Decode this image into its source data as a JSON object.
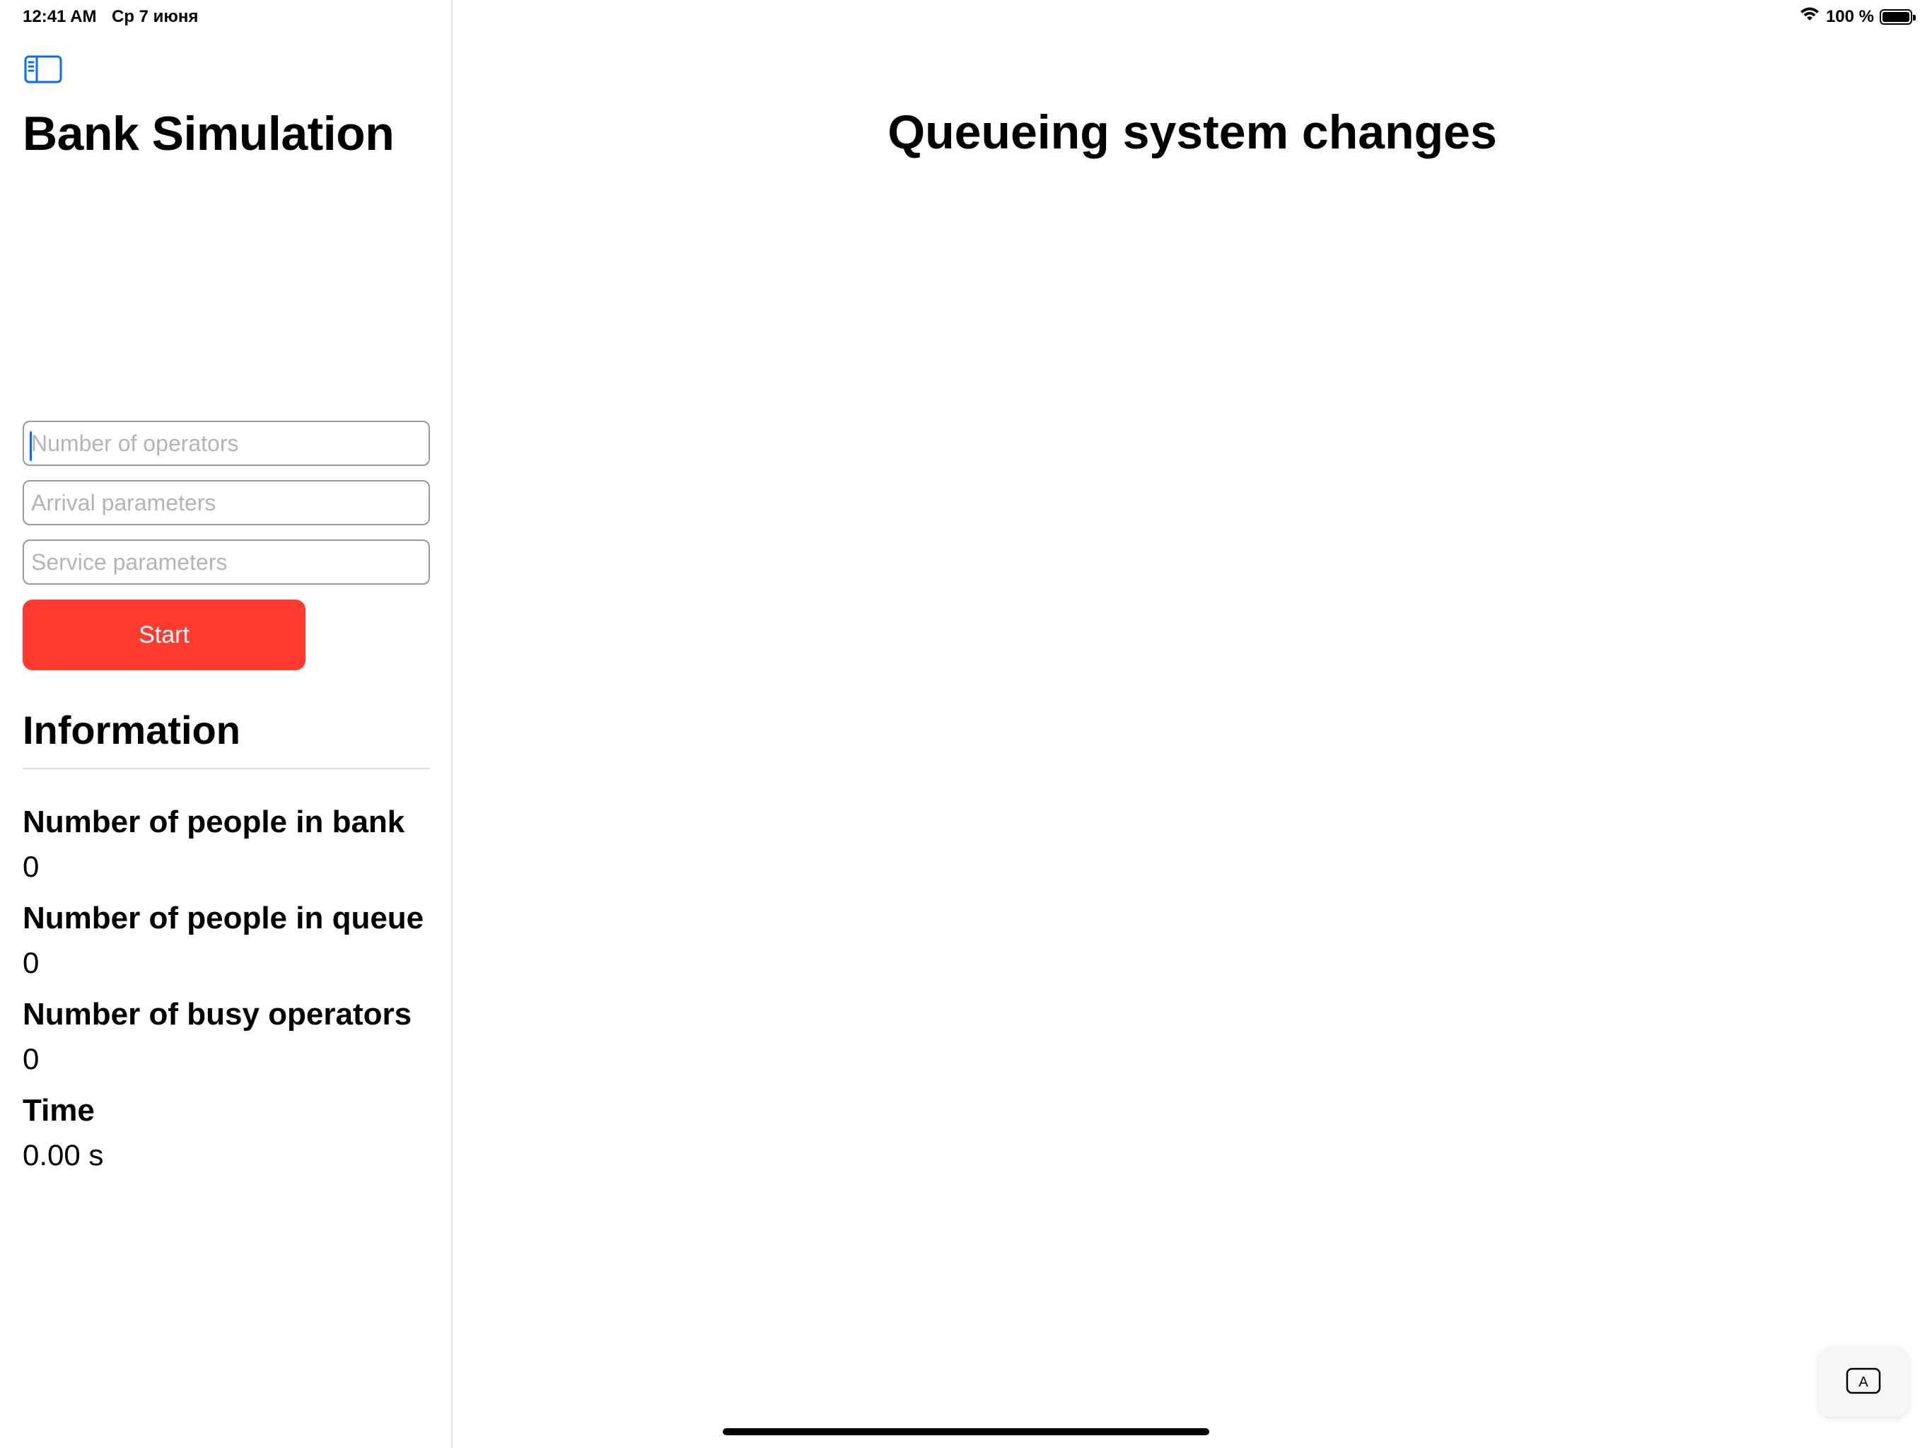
{
  "status_bar": {
    "time": "12:41 AM",
    "date": "Ср 7 июня",
    "battery": "100 %",
    "wifi_icon": "wifi-icon",
    "battery_icon": "battery-full-icon"
  },
  "sidebar": {
    "toggle_icon": "sidebar-toggle-icon",
    "title": "Bank Simulation",
    "fields": {
      "operators": {
        "value": "",
        "placeholder": "Number of operators"
      },
      "arrival": {
        "value": "",
        "placeholder": "Arrival parameters"
      },
      "service": {
        "value": "",
        "placeholder": "Service parameters"
      }
    },
    "start_label": "Start",
    "info_heading": "Information",
    "stats": [
      {
        "label": "Number of people in bank",
        "value": "0"
      },
      {
        "label": "Number of people in queue",
        "value": "0"
      },
      {
        "label": "Number of busy operators",
        "value": "0"
      },
      {
        "label": "Time",
        "value": "0.00 s"
      }
    ]
  },
  "detail": {
    "title": "Queueing system changes"
  },
  "keyboard_button": {
    "icon": "keyboard-shortcut-a-icon",
    "glyph": "A"
  },
  "colors": {
    "accent": "#0a6cff",
    "start_button": "#ff3b30"
  }
}
